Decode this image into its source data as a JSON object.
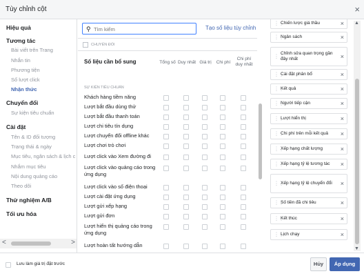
{
  "dialog": {
    "title": "Tùy chỉnh cột",
    "close_glyph": "×"
  },
  "sidebar": {
    "hscroll": {
      "left": "<",
      "right": ">"
    },
    "sections": [
      {
        "label": "Hiệu quả",
        "items": []
      },
      {
        "label": "Tương tác",
        "items": [
          "Bài viết trên Trang",
          "Nhắn tin",
          "Phương tiện",
          "Số lượt click",
          "Nhận thức"
        ]
      },
      {
        "label": "Chuyển đổi",
        "items": [
          "Sự kiện tiêu chuẩn"
        ]
      },
      {
        "label": "Cài đặt",
        "items": [
          "Tên & ID đối tượng",
          "Trạng thái & ngày",
          "Mục tiêu, ngân sách & lịch c",
          "Nhắm mục tiêu",
          "Nội dung quảng cáo",
          "Theo dõi"
        ]
      },
      {
        "label": "Thử nghiệm A/B",
        "items": []
      },
      {
        "label": "Tối ưu hóa",
        "items": []
      }
    ]
  },
  "search": {
    "placeholder": "Tìm kiếm",
    "icon": "search-icon"
  },
  "custom_metrics_link": "Tạo số liệu tùy chỉnh",
  "selected_label": "CHUYỂN ĐỔI",
  "additional_metrics_label": "Số liệu cần bổ sung",
  "columns": [
    "Tổng số",
    "Duy nhất",
    "Giá trị",
    "Chi phí",
    "Chi phí duy nhất"
  ],
  "standard_events_label": "SỰ KIỆN TIÊU CHUẨN",
  "events": [
    "Khách hàng tiềm năng",
    "Lượt bắt đầu dùng thử",
    "Lượt bắt đầu thanh toán",
    "Lượt chi tiêu tín dụng",
    "Lượt chuyển đổi offline khác",
    "Lượt chơi trò chơi",
    "Lượt click vào Xem đường đi",
    "Lượt click vào quảng cáo trong ứng dụng",
    "Lượt click vào số điện thoại",
    "Lượt cài đặt ứng dụng",
    "Lượt gửi xếp hạng",
    "Lượt gửi đơn",
    "Lượt hiển thị quảng cáo trong ứng dụng",
    "Lượt hoàn tất hướng dẫn"
  ],
  "selected_columns": [
    "Chiến lược giá thầu",
    "Ngân sách",
    "Chỉnh sửa quan trọng gần đây nhất",
    "Cài đặt phân bổ",
    "Kết quả",
    "Người tiếp cận",
    "Lượt hiển thị",
    "Chi phí trên mỗi kết quả",
    "Xếp hạng chất lượng",
    "Xếp hạng tỷ lệ tương tác",
    "Xếp hạng tỷ lệ chuyển đổi",
    "Số tiền đã chi tiêu",
    "Kết thúc",
    "Lịch chạy"
  ],
  "chip_remove_glyph": "×",
  "right_scroll": {
    "up": "▲",
    "down": "▼"
  },
  "footer": {
    "save_preset_label": "Lưu làm giá trị đặt trước",
    "cancel": "Hủy",
    "apply": "Áp dụng"
  },
  "colors": {
    "accent": "#4267b2",
    "link": "#4267b2",
    "search_border": "#4080ff"
  }
}
